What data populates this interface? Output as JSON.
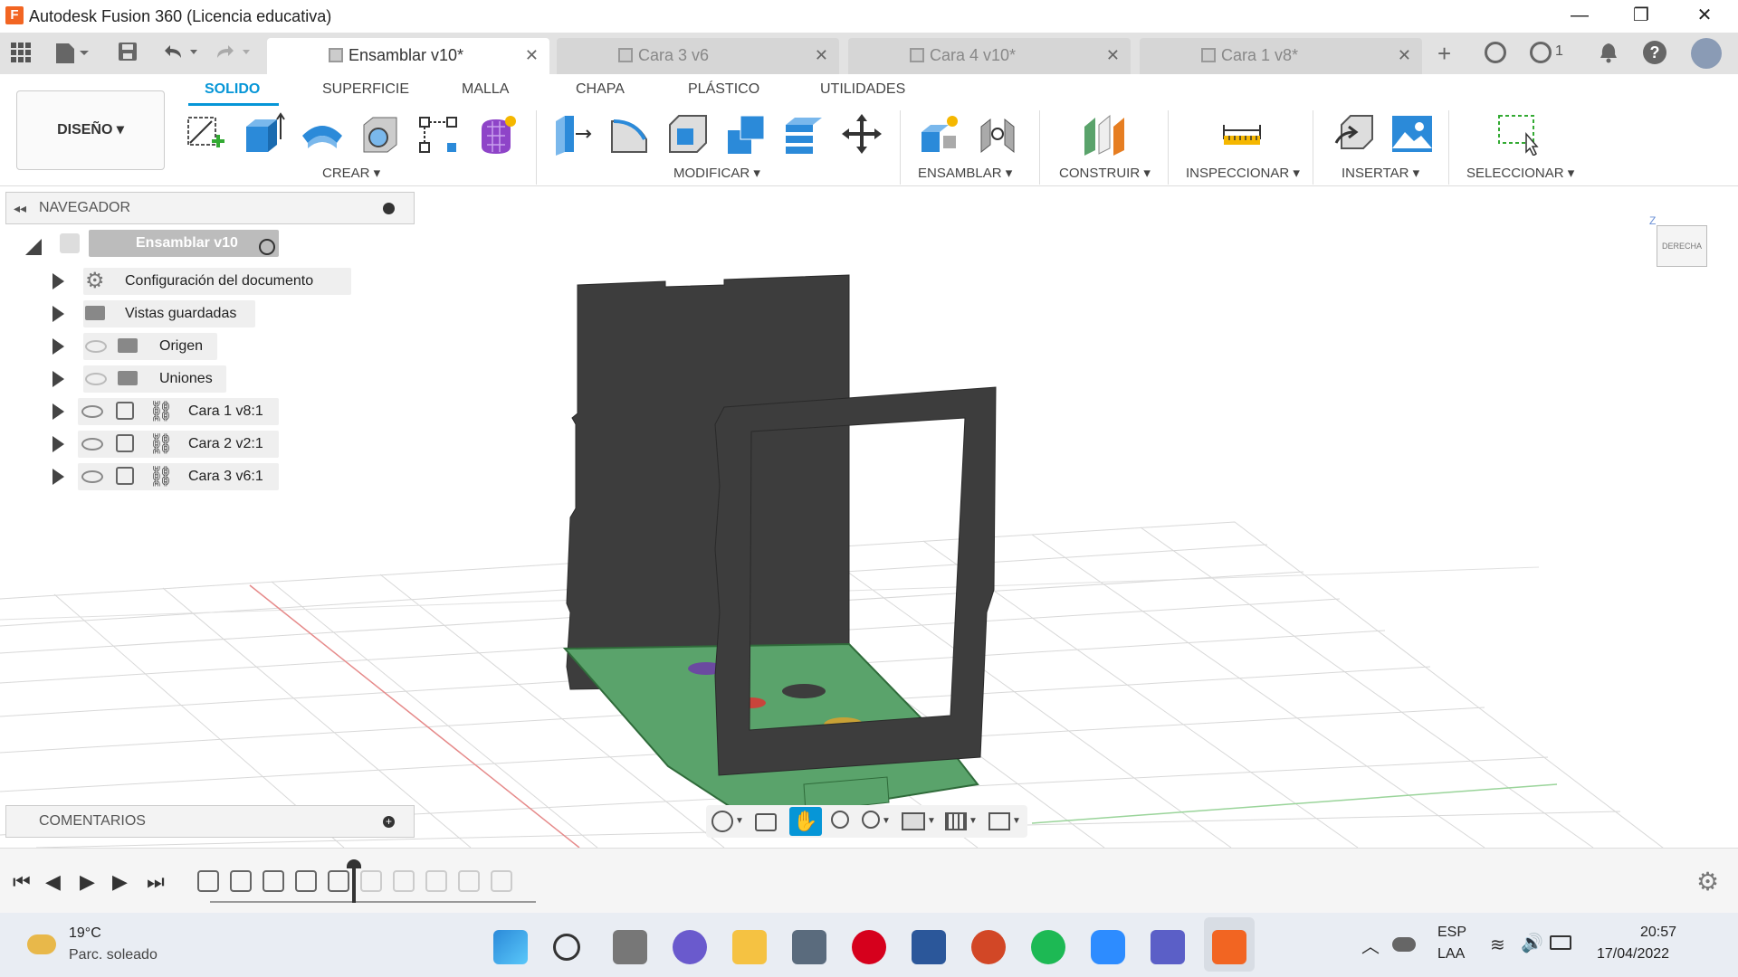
{
  "window": {
    "title": "Autodesk Fusion 360 (Licencia educativa)",
    "logo_letter": "F"
  },
  "tabs": [
    {
      "label": "Ensamblar v10*",
      "active": true
    },
    {
      "label": "Cara 3 v6",
      "active": false
    },
    {
      "label": "Cara 4 v10*",
      "active": false
    },
    {
      "label": "Cara 1 v8*",
      "active": false
    }
  ],
  "tabbar_right": {
    "job_count": "1"
  },
  "ribbon": {
    "workspace": "DISEÑO ▾",
    "tabs": [
      "SOLIDO",
      "SUPERFICIE",
      "MALLA",
      "CHAPA",
      "PLÁSTICO",
      "UTILIDADES"
    ],
    "groups": [
      "CREAR ▾",
      "MODIFICAR ▾",
      "ENSAMBLAR ▾",
      "CONSTRUIR ▾",
      "INSPECCIONAR ▾",
      "INSERTAR ▾",
      "SELECCIONAR ▾"
    ]
  },
  "navigator": {
    "title": "NAVEGADOR",
    "root": "Ensamblar v10",
    "items": [
      {
        "label": "Configuración del documento"
      },
      {
        "label": "Vistas guardadas"
      },
      {
        "label": "Origen"
      },
      {
        "label": "Uniones"
      },
      {
        "label": "Cara 1 v8:1"
      },
      {
        "label": "Cara 2 v2:1"
      },
      {
        "label": "Cara 3 v6:1"
      }
    ]
  },
  "comments": {
    "title": "COMENTARIOS"
  },
  "viewcube": {
    "face": "DERECHA",
    "axis_z": "Z"
  },
  "taskbar": {
    "weather_temp": "19°C",
    "weather_desc": "Parc. soleado",
    "lang1": "ESP",
    "lang2": "LAA",
    "time": "20:57",
    "date": "17/04/2022"
  },
  "colors": {
    "accent": "#0696d7",
    "part_dark": "#3d3d3d",
    "part_green": "#5aa36b",
    "fusion_orange": "#f26522"
  }
}
